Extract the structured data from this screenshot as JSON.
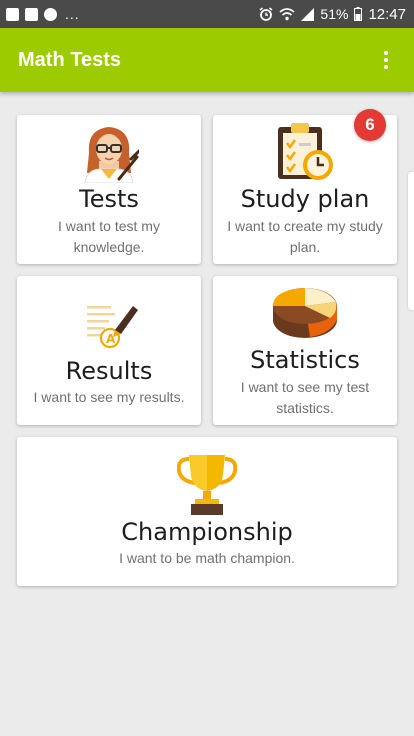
{
  "status_bar": {
    "dots": "...",
    "battery": "51%",
    "time": "12:47"
  },
  "app_bar": {
    "title": "Math Tests"
  },
  "cards": {
    "tests": {
      "title": "Tests",
      "subtitle": "I want to test my knowledge."
    },
    "study_plan": {
      "title": "Study plan",
      "subtitle": "I want to create my study plan.",
      "badge": "6"
    },
    "results": {
      "title": "Results",
      "subtitle": "I want to see my results."
    },
    "statistics": {
      "title": "Statistics",
      "subtitle": "I want to see my test statistics."
    },
    "championship": {
      "title": "Championship",
      "subtitle": "I want to be math champion."
    }
  },
  "colors": {
    "app_bar": "#9ccc00",
    "status_bar": "#4a4a4a",
    "badge": "#e53935",
    "background": "#ebebeb"
  },
  "icons": [
    "teacher-icon",
    "clipboard-clock-icon",
    "pen-grade-icon",
    "pie-chart-icon",
    "trophy-icon"
  ]
}
